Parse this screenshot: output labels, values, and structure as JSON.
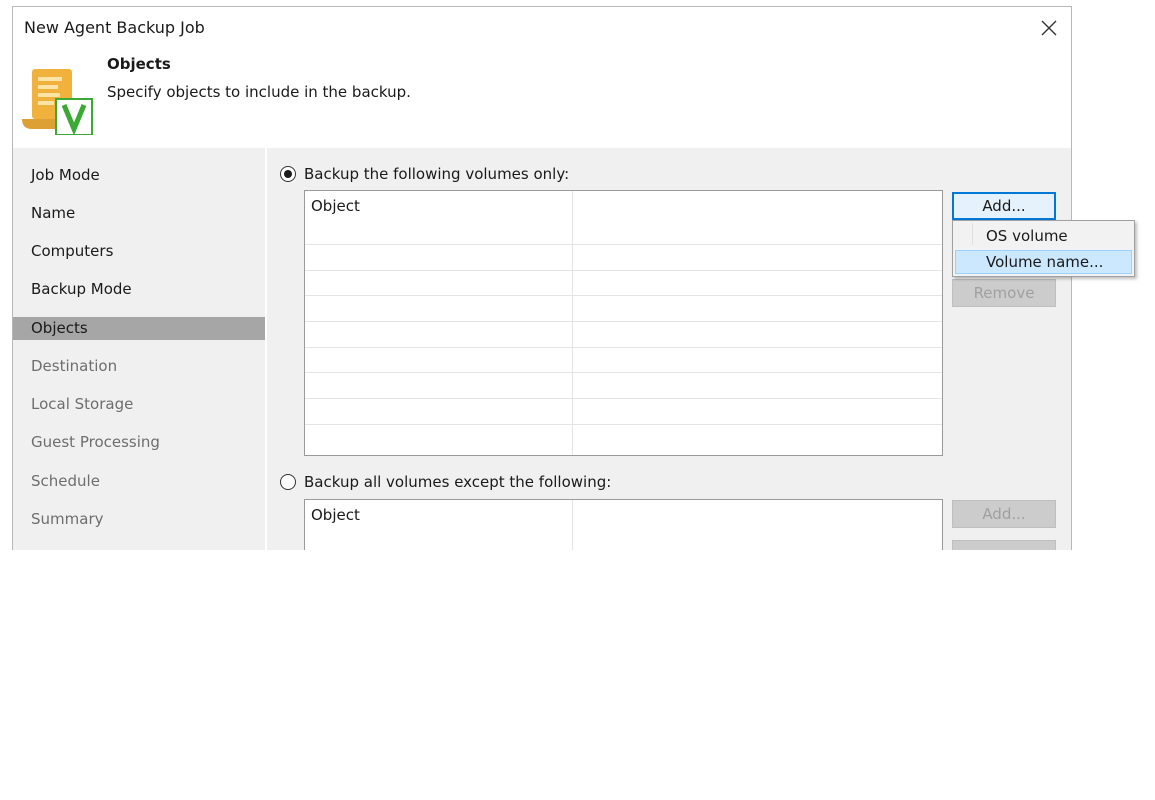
{
  "window": {
    "title": "New Agent Backup Job"
  },
  "header": {
    "title": "Objects",
    "subtitle": "Specify objects to include in the backup."
  },
  "nav": {
    "items": [
      {
        "label": "Job Mode",
        "state": "normal"
      },
      {
        "label": "Name",
        "state": "normal"
      },
      {
        "label": "Computers",
        "state": "normal"
      },
      {
        "label": "Backup Mode",
        "state": "normal"
      },
      {
        "label": "Objects",
        "state": "selected"
      },
      {
        "label": "Destination",
        "state": "disabled"
      },
      {
        "label": "Local Storage",
        "state": "disabled"
      },
      {
        "label": "Guest Processing",
        "state": "disabled"
      },
      {
        "label": "Schedule",
        "state": "disabled"
      },
      {
        "label": "Summary",
        "state": "disabled"
      }
    ]
  },
  "include_section": {
    "radio_label": "Backup the following volumes only:",
    "selected": true,
    "columns": [
      "Object",
      ""
    ],
    "add_label": "Add...",
    "remove_label": "Remove"
  },
  "exclude_section": {
    "radio_label": "Backup all volumes except the following:",
    "selected": false,
    "columns": [
      "Object",
      ""
    ],
    "add_label": "Add..."
  },
  "add_menu": {
    "items": [
      {
        "label": "OS volume",
        "highlighted": false
      },
      {
        "label": "Volume name...",
        "highlighted": true
      }
    ]
  },
  "colors": {
    "accent": "#0078d7",
    "nav_selected": "#a6a6a6",
    "menu_highlight": "#cce8ff",
    "icon_scroll": "#f0b23d",
    "icon_check": "#3aaa35"
  }
}
